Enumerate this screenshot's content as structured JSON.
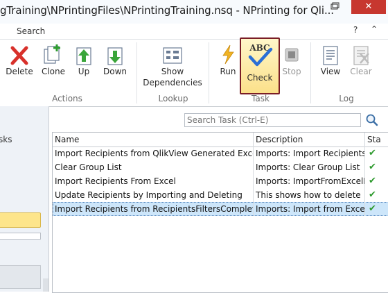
{
  "window": {
    "title": "gTraining\\NPrintingFiles\\NPrintingTraining.nsq - NPrinting for Qli...",
    "close_glyph": "✕"
  },
  "tabs": {
    "search": "Search",
    "help_glyph": "?",
    "collapse_glyph": "⌃"
  },
  "ribbon": {
    "buttons": {
      "delete": "Delete",
      "clone": "Clone",
      "up": "Up",
      "down": "Down",
      "show_dependencies_line1": "Show",
      "show_dependencies_line2": "Dependencies",
      "run": "Run",
      "check": "Check",
      "stop": "Stop",
      "view": "View",
      "clear": "Clear"
    },
    "groups": {
      "actions": "Actions",
      "lookup": "Lookup",
      "task": "Task",
      "log": "Log"
    },
    "check_icon_text": "ABC"
  },
  "left_panel": {
    "text": "sks"
  },
  "search": {
    "placeholder": "Search Task (Ctrl-E)"
  },
  "table": {
    "columns": [
      "Name",
      "Description",
      "Sta"
    ],
    "rows": [
      {
        "name": "Import Recipients from QlikView Generated Excel File",
        "description": "Imports: Import Recipients",
        "status": "✔"
      },
      {
        "name": "Clear Group List",
        "description": "Imports: Clear Group List",
        "status": "✔"
      },
      {
        "name": "Import Recipients From Excel",
        "description": "Imports: ImportFromExcelFile",
        "status": "✔"
      },
      {
        "name": "Update Recipients by Importing and Deleting",
        "description": "This shows how to delete",
        "status": "✔"
      },
      {
        "name": "Import Recipients from RecipientsFiltersComplete.xlsx",
        "description": "Imports: Import from Excel",
        "status": "✔"
      }
    ],
    "selected_row": 4
  },
  "colors": {
    "accent_highlight": "#7a1d26",
    "close_button": "#c7372f",
    "selection": "#cde6fa",
    "status_ok": "#2e9a2e"
  }
}
